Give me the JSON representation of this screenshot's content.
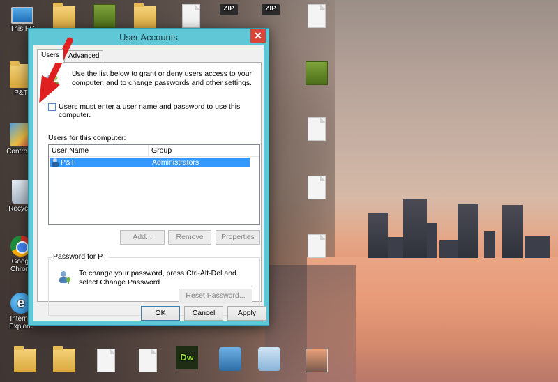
{
  "desktop": {
    "icons": [
      {
        "label": "This PC",
        "kind": "monitor"
      },
      {
        "label": "P&T",
        "kind": "folder"
      },
      {
        "label": "Control P",
        "kind": "cpanel"
      },
      {
        "label": "Recycle",
        "kind": "recycle"
      },
      {
        "label": "Googl Chrom",
        "kind": "chrome"
      },
      {
        "label": "Interne Explore",
        "kind": "ie"
      },
      {
        "label": "ZIP",
        "kind": "zip"
      },
      {
        "label": "ZIP",
        "kind": "zip"
      },
      {
        "label": "Dw",
        "kind": "dw"
      }
    ]
  },
  "dialog": {
    "title": "User Accounts",
    "close_label": "✕",
    "tabs": [
      {
        "label": "Users"
      },
      {
        "label": "Advanced"
      }
    ],
    "intro_text": "Use the list below to grant or deny users access to your computer, and to change passwords and other settings.",
    "must_login_label": "Users must enter a user name and password to use this computer.",
    "must_login_checked": false,
    "users_label": "Users for this computer:",
    "columns": [
      "User Name",
      "Group"
    ],
    "users": [
      {
        "name": "P&T",
        "group": "Administrators",
        "selected": true
      }
    ],
    "buttons": {
      "add": "Add...",
      "remove": "Remove",
      "properties": "Properties"
    },
    "password_group": {
      "legend": "Password for PT",
      "text": "To change your password, press Ctrl-Alt-Del and select Change Password.",
      "reset_label": "Reset Password..."
    },
    "footer": {
      "ok": "OK",
      "cancel": "Cancel",
      "apply": "Apply"
    }
  },
  "colors": {
    "dialog_frame": "#5fc7d6",
    "selection": "#3399ff",
    "close": "#d9453b",
    "annotation_arrow": "#e02020"
  }
}
